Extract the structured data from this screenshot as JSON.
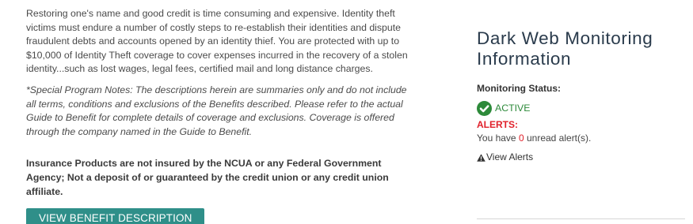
{
  "benefit": {
    "description": "Restoring one's name and good credit is time consuming and expensive. Identity theft victims must endure a number of costly steps to re-establish their identities and dispute fraudulent debts and accounts opened by an identity thief. You are protected with up to $10,000 of Identity Theft coverage to cover expenses incurred in the recovery of a stolen identity...such as lost wages, legal fees, certified mail and long distance charges.",
    "program_notes": "*Special Program Notes: The descriptions herein are summaries only and do not include all terms, conditions and exclusions of the Benefits described. Please refer to the actual Guide to Benefit for complete details of coverage and exclusions. Coverage is offered through the company named in the Guide to Benefit.",
    "insurance_disclaimer": "Insurance Products are not insured by the NCUA or any Federal Government Agency; Not a deposit of or guaranteed by the credit union or any credit union affiliate.",
    "button_label": "VIEW BENEFIT DESCRIPTION"
  },
  "dark_web": {
    "title": "Dark Web Monitoring Information",
    "monitoring_status_label": "Monitoring Status:",
    "status_value": "ACTIVE",
    "status_icon": "check-circle-icon",
    "alerts_label": "ALERTS:",
    "alerts_prefix": "You have ",
    "unread_count": "0",
    "alerts_suffix": " unread alert(s).",
    "view_alerts_label": "View Alerts",
    "view_alerts_icon": "warning-icon"
  },
  "colors": {
    "button_bg": "#2f8f89",
    "title": "#2a3b4c",
    "status_active": "#2d8a3a",
    "alert_red": "#e0202a"
  }
}
